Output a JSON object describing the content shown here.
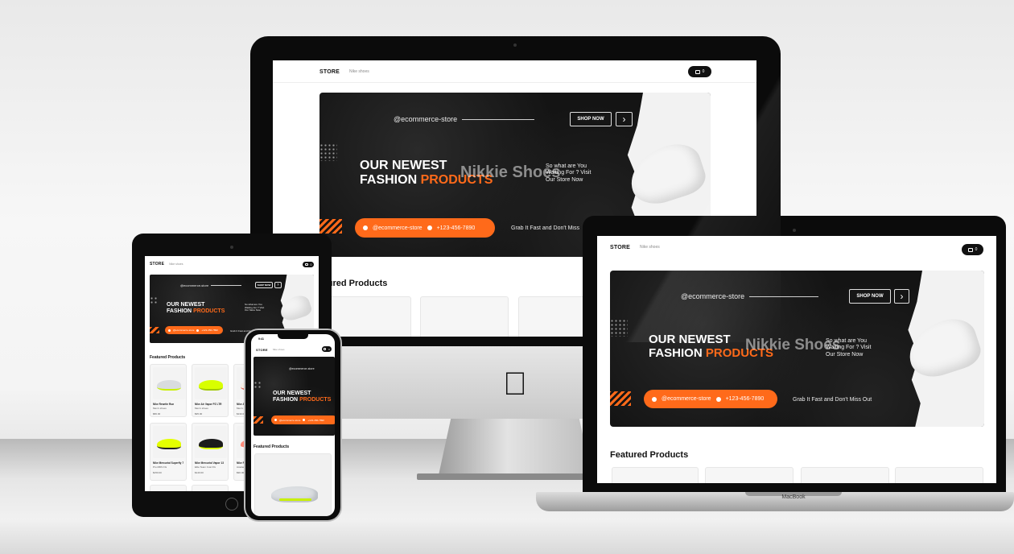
{
  "store": {
    "logo": "STORE",
    "nav_link": "Nike shoes",
    "cart_count": "0"
  },
  "hero": {
    "handle": "@ecommerce-store",
    "shop_button": "SHOP NOW",
    "arrow": "›",
    "headline_line1": "OUR NEWEST",
    "headline_line2_white": "FASHION",
    "headline_line2_accent": "PRODUCTS",
    "brand_overlay": "Nikkie Shoes",
    "subtext_line1": "So what are You",
    "subtext_line2": "Waiting For ? Visit",
    "subtext_line3": "Our Store Now",
    "contact_handle": "@ecommerce-store",
    "phone": "+123-456-7890",
    "tagline": "Grab It Fast and Don't Miss Out"
  },
  "featured": {
    "title": "Featured Products",
    "title_clipped": "atured Products"
  },
  "phone_status": {
    "time": "9:41"
  },
  "laptop": {
    "label": "MacBook"
  },
  "products": [
    {
      "name": "Nike Rewrite Run",
      "sub": "Men's shoes",
      "price": "$80.00",
      "color": "#d9dcdf",
      "accent": "#c8f000"
    },
    {
      "name": "Nike Air Vapor PZ LTR",
      "sub": "Men's shoes",
      "price": "$95.00",
      "color": "#d8ff00",
      "accent": "#a0c800"
    },
    {
      "name": "Nike Air",
      "sub": "Men's shoes",
      "price": "$130.00",
      "color": "#f6eee6",
      "accent": "#e25b4b"
    },
    {
      "name": "Nike Mercurial Superfly 7",
      "sub": "Pro MDS FG",
      "price": "$150.00",
      "color": "#e4ff00",
      "accent": "#202020"
    },
    {
      "name": "Nike Mercurial Vapor 13",
      "sub": "Elite Team Cust FG",
      "price": "$140.00",
      "color": "#1b1b1b",
      "accent": "#d8ff00"
    },
    {
      "name": "Nike Phantom",
      "sub": "Academy",
      "price": "$90.00",
      "color": "#ff8b7a",
      "accent": "#ffffff"
    }
  ],
  "colors": {
    "accent": "#ff6a1a",
    "hero_bg": "#141414"
  }
}
